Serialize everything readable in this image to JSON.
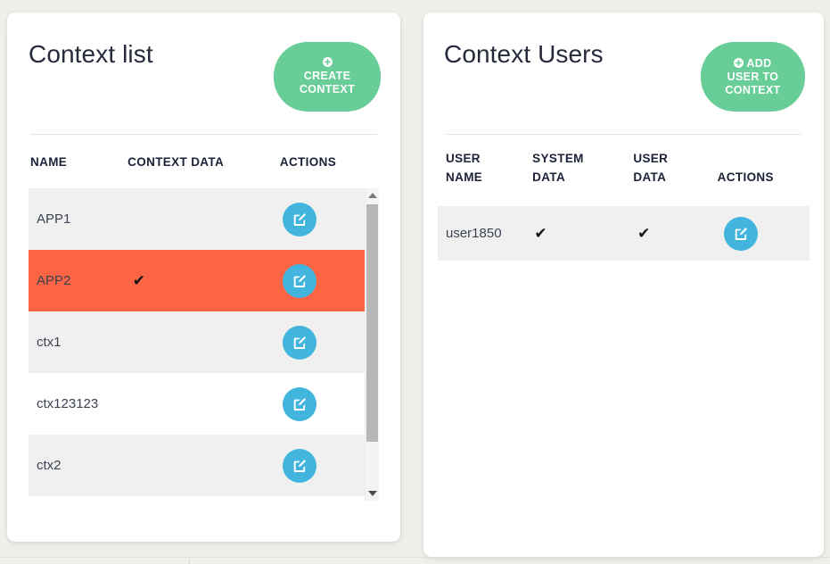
{
  "page": {
    "background_color": "#f1efea",
    "accent_green": "#68cd96",
    "accent_blue": "#41b5dd",
    "selected_row_color": "#fb6444",
    "shaded_row_color": "#f0f0f0"
  },
  "context_list": {
    "title": "Context list",
    "create_button": {
      "icon": "plus-circle-icon",
      "line1": "CREATE",
      "line2": "CONTEXT"
    },
    "columns": [
      "NAME",
      "CONTEXT DATA",
      "ACTIONS"
    ],
    "rows": [
      {
        "name": "APP1",
        "context_data": "",
        "action_icon": "edit-pencil-icon",
        "style": "shade",
        "selected": false
      },
      {
        "name": "APP2",
        "context_data": "✔",
        "action_icon": "edit-pencil-icon",
        "style": "selected",
        "selected": true
      },
      {
        "name": "ctx1",
        "context_data": "",
        "action_icon": "edit-pencil-icon",
        "style": "shade",
        "selected": false
      },
      {
        "name": "ctx123123",
        "context_data": "",
        "action_icon": "edit-pencil-icon",
        "style": "plain",
        "selected": false
      },
      {
        "name": "ctx2",
        "context_data": "",
        "action_icon": "edit-pencil-icon",
        "style": "shade",
        "selected": false
      }
    ],
    "scrollbar": {
      "up_icon": "triangle-up-icon",
      "down_icon": "triangle-down-icon",
      "thumb": "scroll-thumb"
    }
  },
  "context_users": {
    "title": "Context Users",
    "add_button": {
      "icon": "plus-circle-icon",
      "line1": "ADD",
      "line2": "USER TO",
      "line3": "CONTEXT"
    },
    "columns": [
      "USER\nNAME",
      "SYSTEM\nDATA",
      "USER\nDATA",
      "ACTIONS"
    ],
    "rows": [
      {
        "user_name": "user1850",
        "system_data": "✔",
        "user_data": "✔",
        "action_icon": "edit-pencil-icon"
      }
    ]
  }
}
